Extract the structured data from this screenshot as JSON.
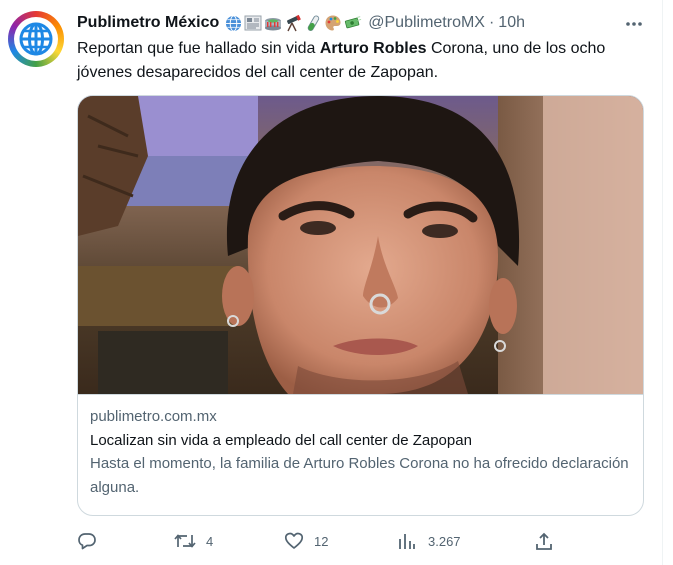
{
  "tweet": {
    "display_name": "Publimetro México",
    "name_emojis": [
      "globe-icon",
      "newspaper-icon",
      "stadium-icon",
      "telescope-icon",
      "test-tube-icon",
      "palette-icon",
      "money-icon"
    ],
    "handle": "@PublimetroMX",
    "separator": "·",
    "time": "10h",
    "text_before": "Reportan que fue hallado sin vida ",
    "text_bold": "Arturo Robles",
    "text_after": " Corona, uno de los ocho jóvenes desaparecidos del call center de Zapopan."
  },
  "card": {
    "domain": "publimetro.com.mx",
    "title": "Localizan sin vida a empleado del call center de Zapopan",
    "description": "Hasta el momento, la familia de Arturo Robles Corona no ha ofrecido declaración alguna."
  },
  "actions": {
    "reply_count": "",
    "retweet_count": "4",
    "like_count": "12",
    "views_count": "3.267",
    "share_count": ""
  },
  "colors": {
    "text_primary": "#0f1419",
    "text_secondary": "#536471",
    "border": "#cfd9de",
    "avatar_globe": "#1e88e5"
  }
}
